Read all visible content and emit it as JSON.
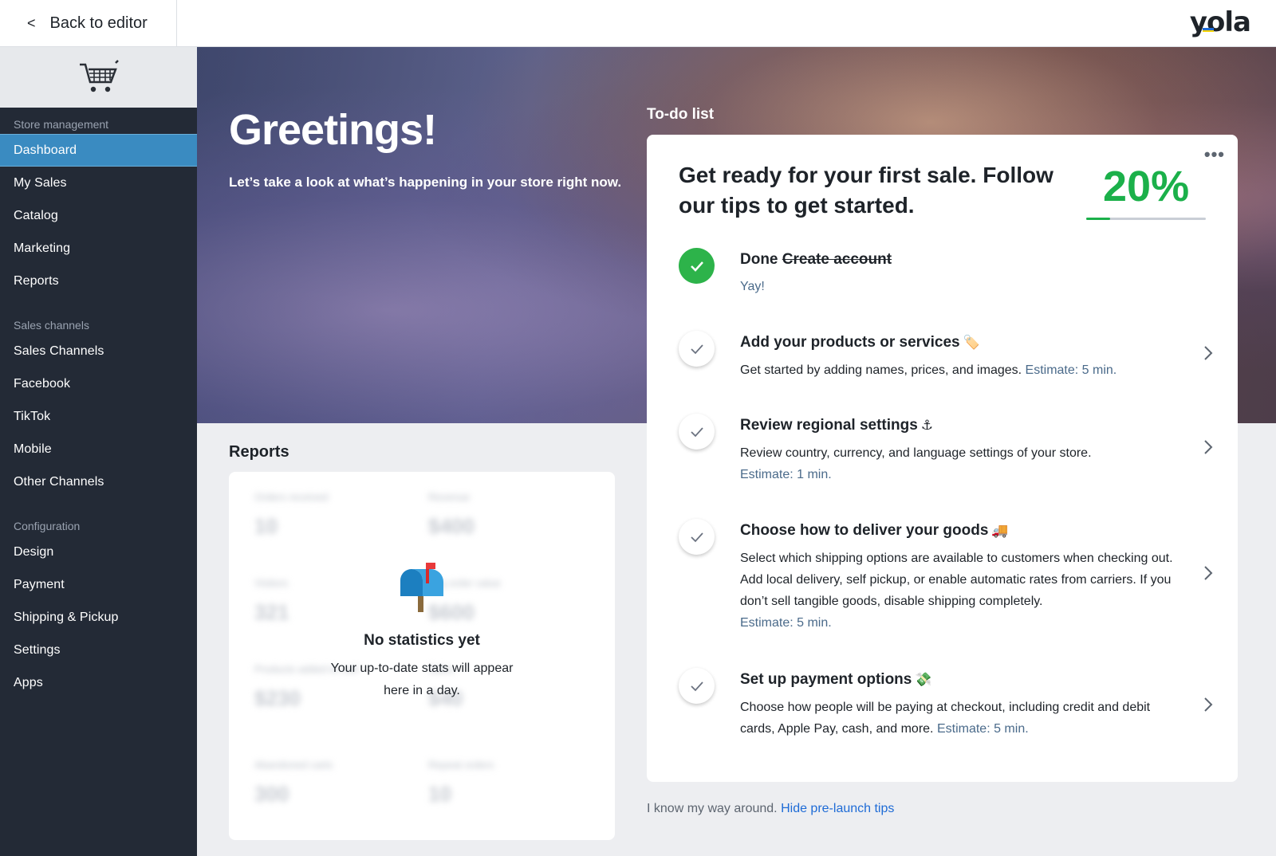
{
  "topbar": {
    "back_label": "Back to editor",
    "logo_text": "yola"
  },
  "sidebar": {
    "groups": [
      {
        "title": "Store management",
        "items": [
          "Dashboard",
          "My Sales",
          "Catalog",
          "Marketing",
          "Reports"
        ]
      },
      {
        "title": "Sales channels",
        "items": [
          "Sales Channels",
          "Facebook",
          "TikTok",
          "Mobile",
          "Other Channels"
        ]
      },
      {
        "title": "Configuration",
        "items": [
          "Design",
          "Payment",
          "Shipping & Pickup",
          "Settings",
          "Apps"
        ]
      }
    ],
    "active_item": "Dashboard"
  },
  "hero": {
    "greeting": "Greetings!",
    "subtitle": "Let’s take a look at what’s happening in your store right now."
  },
  "reports": {
    "title": "Reports",
    "empty_title": "No statistics yet",
    "empty_text_line1": "Your up-to-date stats will appear",
    "empty_text_line2": "here in a day.",
    "blurred_values": [
      "10",
      "$400",
      "321",
      "$600",
      "$230",
      "$40",
      "300",
      "10"
    ]
  },
  "todo": {
    "section_title": "To-do list",
    "heading": "Get ready for your first sale. Follow our tips to get started.",
    "progress_label": "20%",
    "progress": 0.2,
    "steps": [
      {
        "done_word": "Done",
        "title": "Create account",
        "note": "Yay!",
        "done": true
      },
      {
        "title": "Add your products or services",
        "emoji": "🏷️",
        "desc": "Get started by adding names, prices, and images.",
        "estimate": "Estimate: 5 min."
      },
      {
        "title": "Review regional settings",
        "emoji": "⚓",
        "desc": "Review country, currency, and language settings of your store.",
        "estimate": "Estimate: 1 min."
      },
      {
        "title": "Choose how to deliver your goods",
        "emoji": "🚚",
        "desc": "Select which shipping options are available to customers when checking out. Add local delivery, self pickup, or enable automatic rates from carriers. If you don’t sell tangible goods, disable shipping completely.",
        "estimate": "Estimate: 5 min."
      },
      {
        "title": "Set up payment options",
        "emoji": "💸",
        "desc": "Choose how people will be paying at checkout, including credit and debit cards, Apple Pay, cash, and more.",
        "estimate": "Estimate: 5 min."
      }
    ],
    "footer_text": "I know my way around.",
    "footer_link": "Hide pre-launch tips"
  },
  "colors": {
    "accent_green": "#1bb04a",
    "sidebar_bg": "#232a36",
    "active_nav": "#3a8bc1",
    "link_blue": "#1e6bd6"
  }
}
